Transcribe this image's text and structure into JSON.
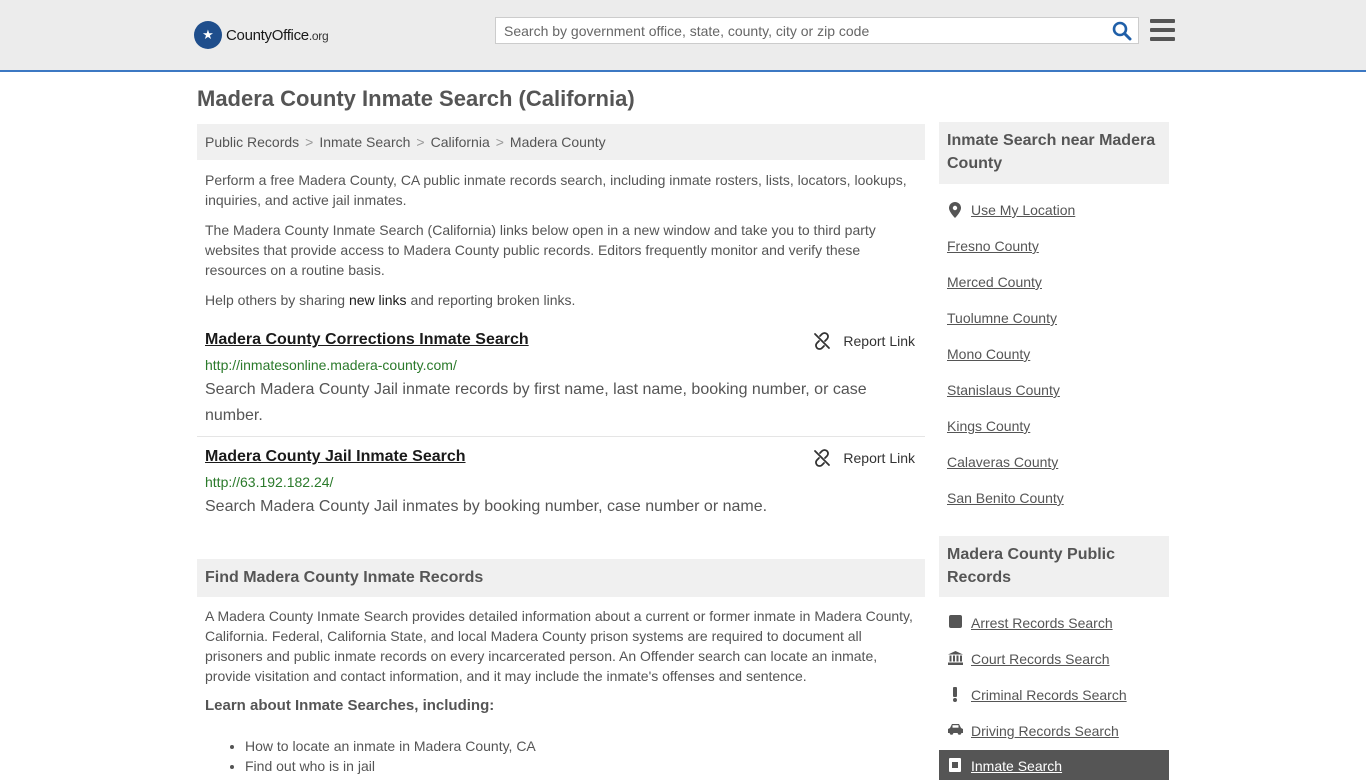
{
  "header": {
    "logo_name": "CountyOffice",
    "logo_tld": ".org",
    "search_placeholder": "Search by government office, state, county, city or zip code"
  },
  "page": {
    "title": "Madera County Inmate Search (California)"
  },
  "breadcrumb": [
    "Public Records",
    "Inmate Search",
    "California",
    "Madera County"
  ],
  "intro": {
    "p1": "Perform a free Madera County, CA public inmate records search, including inmate rosters, lists, locators, lookups, inquiries, and active jail inmates.",
    "p2": "The Madera County Inmate Search (California) links below open in a new window and take you to third party websites that provide access to Madera County public records. Editors frequently monitor and verify these resources on a routine basis.",
    "p3_before": "Help others by sharing ",
    "p3_link": "new links",
    "p3_after": " and reporting broken links."
  },
  "results": [
    {
      "title": "Madera County Corrections Inmate Search",
      "url": "http://inmatesonline.madera-county.com/",
      "description": "Search Madera County Jail inmate records by first name, last name, booking number, or case number.",
      "report_label": "Report Link"
    },
    {
      "title": "Madera County Jail Inmate Search",
      "url": "http://63.192.182.24/",
      "description": "Search Madera County Jail inmates by booking number, case number or name.",
      "report_label": "Report Link"
    }
  ],
  "find_section": {
    "heading": "Find Madera County Inmate Records",
    "body": "A Madera County Inmate Search provides detailed information about a current or former inmate in Madera County, California. Federal, California State, and local Madera County prison systems are required to document all prisoners and public inmate records on every incarcerated person. An Offender search can locate an inmate, provide visitation and contact information, and it may include the inmate's offenses and sentence.",
    "learn_heading": "Learn about Inmate Searches, including:",
    "bullets": [
      "How to locate an inmate in Madera County, CA",
      "Find out who is in jail"
    ]
  },
  "sidebar": {
    "nearby_heading": "Inmate Search near Madera County",
    "nearby": [
      {
        "label": "Use My Location",
        "icon": "location-pin-icon"
      },
      {
        "label": "Fresno County"
      },
      {
        "label": "Merced County"
      },
      {
        "label": "Tuolumne County"
      },
      {
        "label": "Mono County"
      },
      {
        "label": "Stanislaus County"
      },
      {
        "label": "Kings County"
      },
      {
        "label": "Calaveras County"
      },
      {
        "label": "San Benito County"
      }
    ],
    "records_heading": "Madera County Public Records",
    "records": [
      {
        "label": "Arrest Records Search",
        "icon": "square-icon"
      },
      {
        "label": "Court Records Search",
        "icon": "courthouse-icon"
      },
      {
        "label": "Criminal Records Search",
        "icon": "exclamation-icon"
      },
      {
        "label": "Driving Records Search",
        "icon": "car-icon"
      }
    ],
    "active_item": {
      "label": "Inmate Search",
      "icon": "jail-icon"
    }
  },
  "colors": {
    "header_bg": "#ececec",
    "header_border": "#3c78c3",
    "url_green": "#2b7a2b",
    "active_bg": "#555555"
  }
}
